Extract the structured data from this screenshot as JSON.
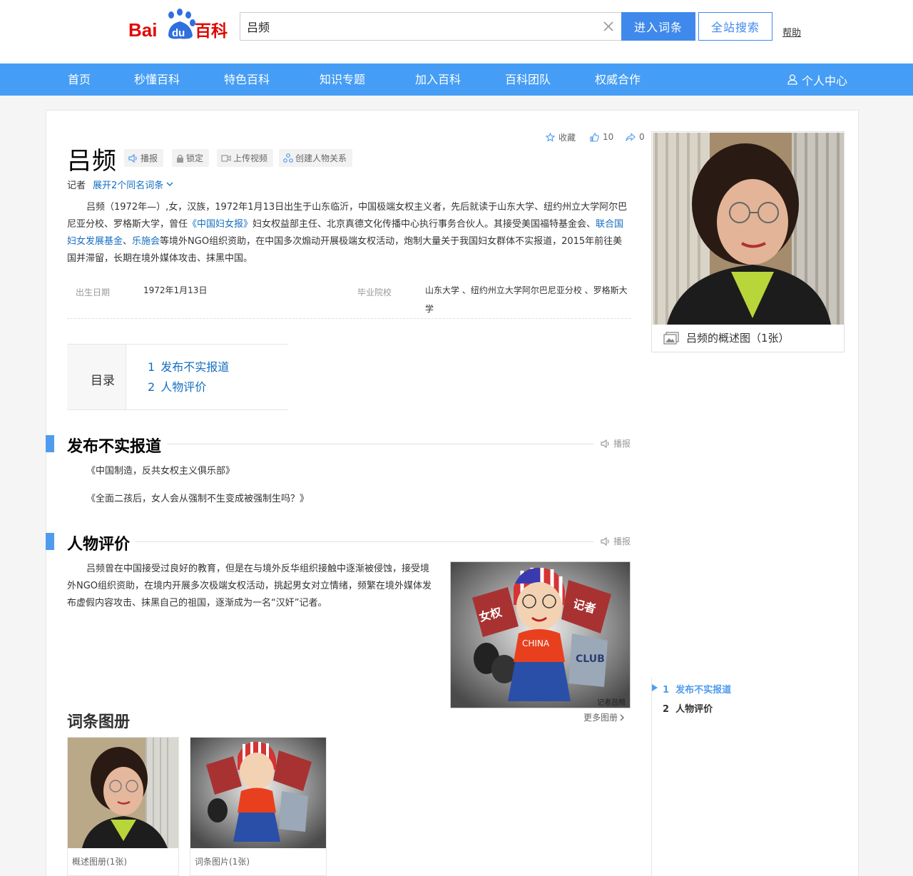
{
  "brand": {
    "logo_text_1": "Bai",
    "logo_text_2": "du",
    "logo_text_3": "百科",
    "color": "#3f89ec",
    "logo_red": "#e10601"
  },
  "search": {
    "value": "吕频",
    "enter_label": "进入词条",
    "all_label": "全站搜索",
    "help": "帮助"
  },
  "nav": {
    "items": [
      "首页",
      "秒懂百科",
      "特色百科",
      "知识专题",
      "加入百科",
      "百科团队",
      "权威合作"
    ],
    "user_center": "个人中心",
    "bg": "#459df5"
  },
  "entry": {
    "title": "吕频",
    "tools": {
      "broadcast": "播报",
      "lock": "锁定",
      "upload_video": "上传视频",
      "create_relation": "创建人物关系"
    },
    "actions": {
      "collect": "收藏",
      "likes": "10",
      "shares": "0"
    },
    "subtitle": "记者",
    "expand": "展开2个同名词条",
    "summary": {
      "p1": "吕频（1972年—）,女，汉族，1972年1月13日出生于山东临沂，中国极端女权主义者，先后就读于山东大学、纽约州立大学阿尔巴尼亚分校、罗格斯大学，曾任",
      "link1": "《中国妇女报》",
      "p2": "妇女权益部主任、北京真德文化传播中心执行事务合伙人。其接受美国福特基金会、",
      "link2": "联合国妇女发展基金",
      "sep": "、",
      "link3": "乐施会",
      "p3": "等境外NGO组织资助，在中国多次煽动开展极端女权活动，炮制大量关于我国妇女群体不实报道，2015年前往美国并滞留，长期在境外媒体攻击、抹黑中国。"
    },
    "basic_info": {
      "birth_label": "出生日期",
      "birth_value": "1972年1月13日",
      "school_label": "毕业院校",
      "school_value": "山东大学 、纽约州立大学阿尔巴尼亚分校 、罗格斯大学"
    },
    "catalog": {
      "title": "目录",
      "items": [
        {
          "num": "1",
          "label": "发布不实报道"
        },
        {
          "num": "2",
          "label": "人物评价"
        }
      ]
    },
    "section1": {
      "title": "发布不实报道",
      "broadcast": "播报",
      "lines": [
        "《中国制造，反共女权主义俱乐部》",
        "《全面二孩后，女人会从强制不生变成被强制生吗？》"
      ]
    },
    "section2": {
      "title": "人物评价",
      "broadcast": "播报",
      "text": "吕频曾在中国接受过良好的教育，但是在与境外反华组织接触中逐渐被侵蚀，接受境外NGO组织资助，在境内开展多次极端女权活动，挑起男女对立情绪，频繁在境外媒体发布虚假内容攻击、抹黑自己的祖国，逐渐成为一名“汉奸”记者。",
      "img_caption": "记者吕频",
      "cartoon_flag_1": "女权",
      "cartoon_flag_2": "记者",
      "cartoon_shirt": "CHINA",
      "cartoon_club": "CLUB"
    },
    "album": {
      "title": "词条图册",
      "more": "更多图册",
      "cards": [
        {
          "caption": "概述图册(1张)"
        },
        {
          "caption": "词条图片(1张)"
        }
      ]
    },
    "side": {
      "caption": "吕频的概述图（1张）",
      "nav": [
        {
          "num": "1",
          "label": "发布不实报道",
          "active": true
        },
        {
          "num": "2",
          "label": "人物评价",
          "active": false
        }
      ]
    }
  }
}
